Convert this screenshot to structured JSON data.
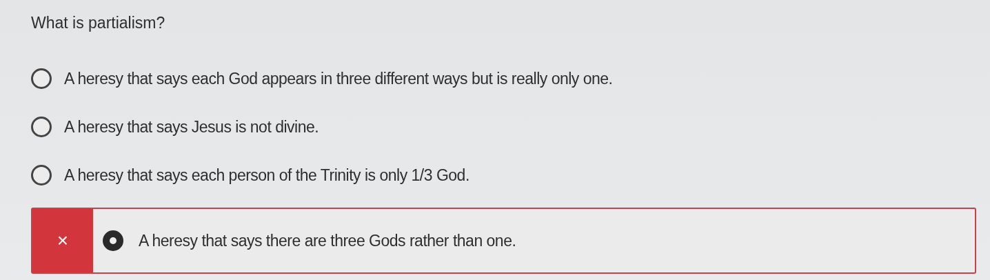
{
  "question": "What is partialism?",
  "options": [
    {
      "label": "A heresy that says each God appears in three different ways but is really only one.",
      "selected": false
    },
    {
      "label": "A heresy that says Jesus is not divine.",
      "selected": false
    },
    {
      "label": "A heresy that says each person of the Trinity is only 1/3 God.",
      "selected": false
    },
    {
      "label": "A heresy that says there are three Gods rather than one.",
      "selected": true,
      "mark": "×"
    }
  ]
}
